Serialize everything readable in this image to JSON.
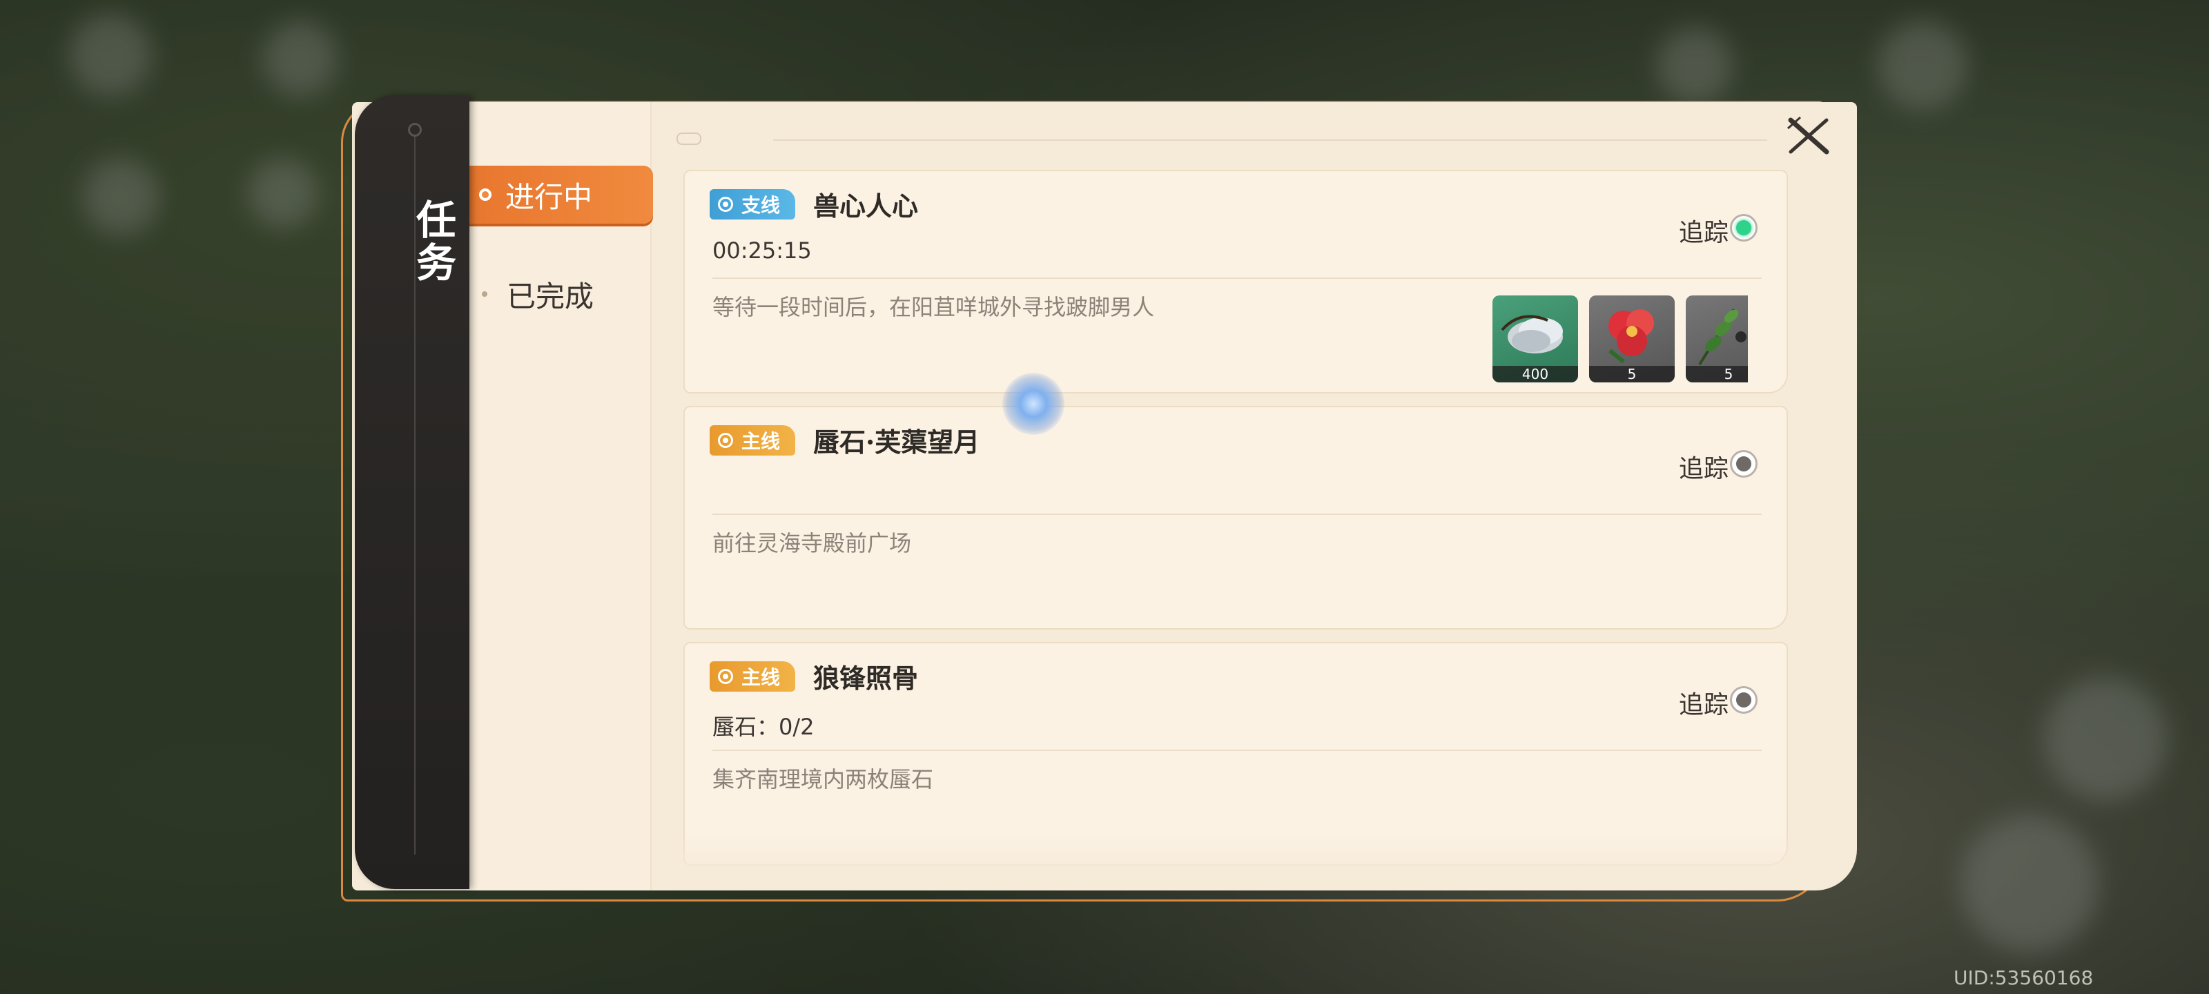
{
  "window": {
    "title": "任务"
  },
  "tabs": [
    {
      "label": "进行中",
      "active": true
    },
    {
      "label": "已完成",
      "active": false
    }
  ],
  "quests": [
    {
      "type": "支线",
      "name": "兽心人心",
      "sub": "00:25:15",
      "desc": "等待一段时间后，在阳苴咩城外寻找跛脚男人",
      "track_label": "追踪",
      "tracked": true,
      "rewards": [
        {
          "icon": "silver-coins-icon",
          "count": "400"
        },
        {
          "icon": "red-flower-icon",
          "count": "5"
        },
        {
          "icon": "green-herb-icon",
          "count": "5"
        }
      ]
    },
    {
      "type": "主线",
      "name": "蜃石·芙蕖望月",
      "sub": "",
      "desc": "前往灵海寺殿前广场",
      "track_label": "追踪",
      "tracked": false
    },
    {
      "type": "主线",
      "name": "狼锋照骨",
      "sub": "蜃石：0/2",
      "desc": "集齐南理境内两枚蜃石",
      "track_label": "追踪",
      "tracked": false
    }
  ],
  "footer": {
    "uid": "UID:53560168"
  },
  "colors": {
    "accent": "#e8772e",
    "side_badge": "#3f9fd6",
    "main_badge": "#e89a2e",
    "tracked": "#2fd28a"
  }
}
